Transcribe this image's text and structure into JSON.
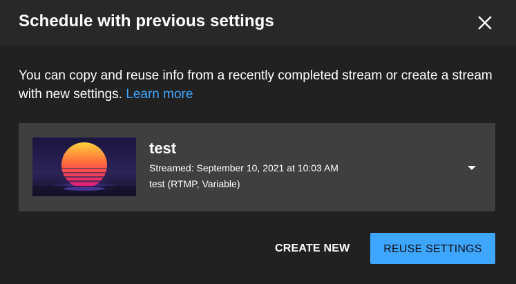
{
  "dialog": {
    "title": "Schedule with previous settings",
    "description": "You can copy and reuse info from a recently completed stream or create a stream with new settings.",
    "learn_more": "Learn more"
  },
  "stream": {
    "name": "test",
    "streamed": "Streamed: September 10, 2021 at 10:03 AM",
    "details": "test (RTMP, Variable)",
    "thumbnail_icon": "sunset-thumbnail",
    "expand_icon": "caret-down-icon"
  },
  "actions": {
    "create_new": "CREATE NEW",
    "reuse_settings": "REUSE SETTINGS"
  },
  "colors": {
    "background": "#212121",
    "header": "#282828",
    "card": "#3f3f3f",
    "accent": "#3ea6ff",
    "text": "#ffffff"
  }
}
